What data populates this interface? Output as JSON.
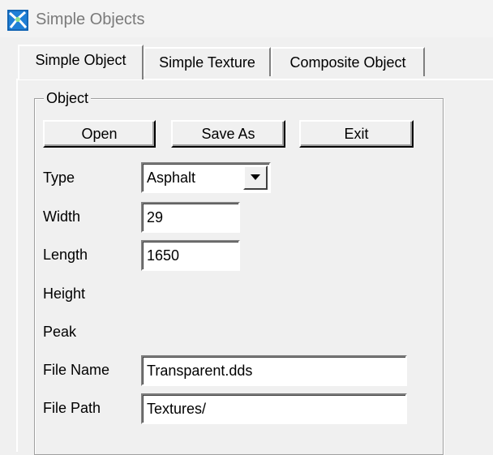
{
  "window": {
    "title": "Simple Objects",
    "icon": "app-logo-icon"
  },
  "tabs": [
    {
      "label": "Simple Object",
      "active": true
    },
    {
      "label": "Simple Texture",
      "active": false
    },
    {
      "label": "Composite Object",
      "active": false
    }
  ],
  "group": {
    "label": "Object"
  },
  "buttons": {
    "open": "Open",
    "save_as": "Save As",
    "exit": "Exit"
  },
  "fields": {
    "type": {
      "label": "Type",
      "value": "Asphalt"
    },
    "width": {
      "label": "Width",
      "value": "29"
    },
    "length": {
      "label": "Length",
      "value": "1650"
    },
    "height": {
      "label": "Height"
    },
    "peak": {
      "label": "Peak"
    },
    "file_name": {
      "label": "File Name",
      "value": "Transparent.dds"
    },
    "file_path": {
      "label": "File Path",
      "value": "Textures/"
    }
  }
}
